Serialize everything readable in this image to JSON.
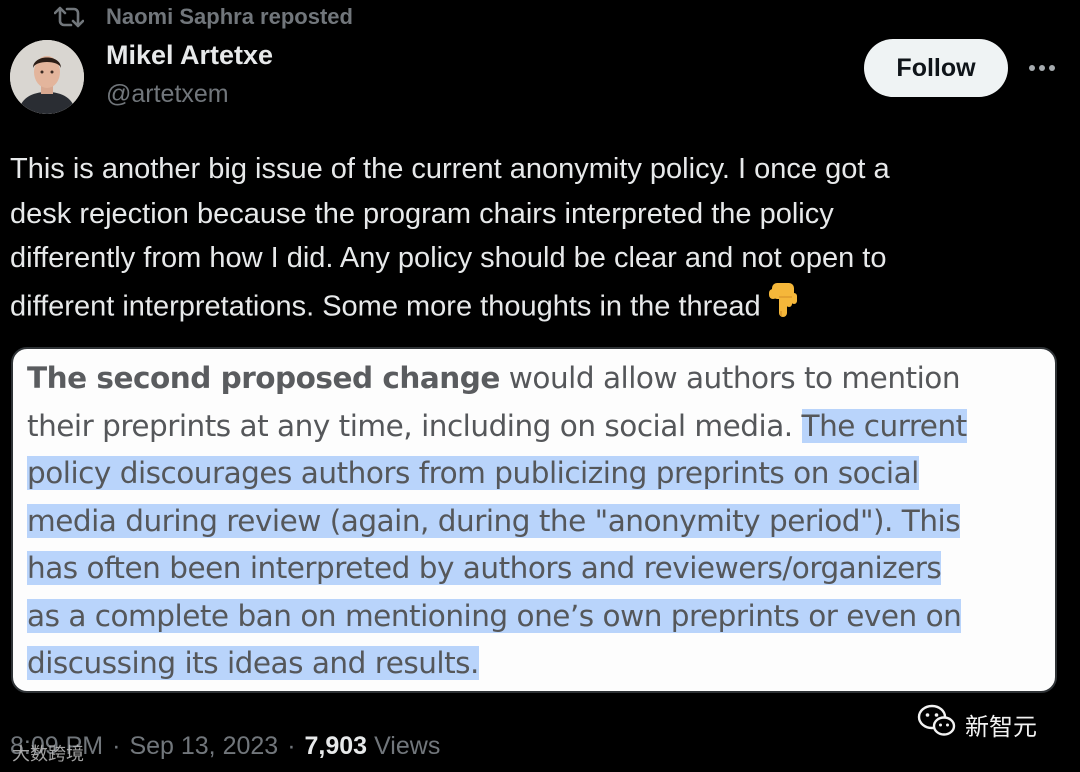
{
  "repost": {
    "label": "Naomi Saphra reposted"
  },
  "author": {
    "name": "Mikel Artetxe",
    "handle": "@artetxem"
  },
  "actions": {
    "follow_label": "Follow"
  },
  "tweet": {
    "lines": [
      "This is another big issue of the current anonymity policy. I once got a",
      "desk rejection because the program chairs interpreted the policy",
      "differently from how I did. Any policy should be clear and not open to",
      "different interpretations. Some more thoughts in the thread"
    ]
  },
  "media": {
    "line1_bold": "The second proposed change",
    "line1_rest": " would allow authors to mention",
    "line2_plain": "their preprints at any time, including on social media. ",
    "line2_hl": "The current",
    "line3": "policy discourages authors from publicizing preprints on social",
    "line4": "media during review (again, during the \"anonymity period\"). This",
    "line5": "has often been interpreted by authors and reviewers/organizers",
    "line6": "as a complete ban on mentioning one’s own preprints or even on",
    "line7": "discussing its ideas and results."
  },
  "meta": {
    "time": "8:09 PM",
    "date": "Sep 13, 2023",
    "separator": "·",
    "views_count": "7,903",
    "views_label": "Views"
  },
  "watermarks": {
    "left": "大数跨境",
    "right": "新智元"
  },
  "icons": {
    "repost": "repost-icon",
    "more": "more-icon",
    "pointing_down": "backhand-index-pointing-down-emoji"
  }
}
